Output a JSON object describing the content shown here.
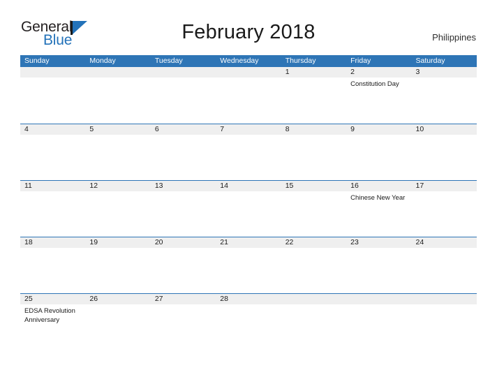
{
  "brand": {
    "name_top": "General",
    "name_bottom": "Blue",
    "flag_icon": "blue-flag-icon",
    "accent_color": "#2372b9"
  },
  "header": {
    "title": "February 2018",
    "country": "Philippines"
  },
  "calendar": {
    "header_bg": "#2e75b6",
    "date_band_bg": "#efefef",
    "rule_color": "#2e75b6",
    "weekdays": [
      "Sunday",
      "Monday",
      "Tuesday",
      "Wednesday",
      "Thursday",
      "Friday",
      "Saturday"
    ],
    "weeks": [
      [
        {
          "date": "",
          "events": []
        },
        {
          "date": "",
          "events": []
        },
        {
          "date": "",
          "events": []
        },
        {
          "date": "",
          "events": []
        },
        {
          "date": "1",
          "events": []
        },
        {
          "date": "2",
          "events": [
            "Constitution Day"
          ]
        },
        {
          "date": "3",
          "events": []
        }
      ],
      [
        {
          "date": "4",
          "events": []
        },
        {
          "date": "5",
          "events": []
        },
        {
          "date": "6",
          "events": []
        },
        {
          "date": "7",
          "events": []
        },
        {
          "date": "8",
          "events": []
        },
        {
          "date": "9",
          "events": []
        },
        {
          "date": "10",
          "events": []
        }
      ],
      [
        {
          "date": "11",
          "events": []
        },
        {
          "date": "12",
          "events": []
        },
        {
          "date": "13",
          "events": []
        },
        {
          "date": "14",
          "events": []
        },
        {
          "date": "15",
          "events": []
        },
        {
          "date": "16",
          "events": [
            "Chinese New Year"
          ]
        },
        {
          "date": "17",
          "events": []
        }
      ],
      [
        {
          "date": "18",
          "events": []
        },
        {
          "date": "19",
          "events": []
        },
        {
          "date": "20",
          "events": []
        },
        {
          "date": "21",
          "events": []
        },
        {
          "date": "22",
          "events": []
        },
        {
          "date": "23",
          "events": []
        },
        {
          "date": "24",
          "events": []
        }
      ],
      [
        {
          "date": "25",
          "events": [
            "EDSA Revolution Anniversary"
          ]
        },
        {
          "date": "26",
          "events": []
        },
        {
          "date": "27",
          "events": []
        },
        {
          "date": "28",
          "events": []
        },
        {
          "date": "",
          "events": []
        },
        {
          "date": "",
          "events": []
        },
        {
          "date": "",
          "events": []
        }
      ]
    ]
  }
}
